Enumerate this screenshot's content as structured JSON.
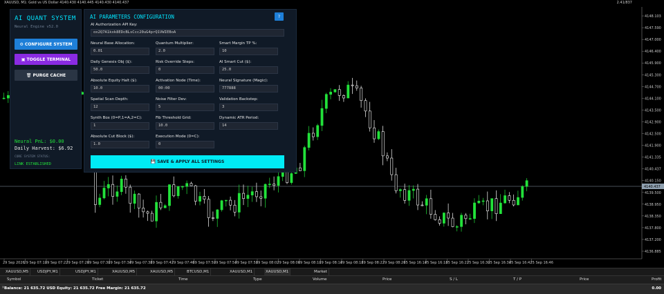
{
  "topbar": {
    "symbol_text": "XAUUSD, M1: Gold vs US Dollar  4140.430 4140.445 4140.430 4140.437",
    "right_text": "2.41/837"
  },
  "colors": {
    "accent_cyan": "#00e5ff",
    "button_blue": "#1e7fd8",
    "button_purple": "#8a2be2",
    "button_gray": "#2a3544",
    "bull_candle": "#22e23a",
    "bear_candle": "#ffffff",
    "panel_bg": "#101a27"
  },
  "left_panel": {
    "title": "AI QUANT SYSTEM",
    "subtitle": "Neural Engine v52.0",
    "buttons": [
      {
        "icon": "settings-icon",
        "label": "CONFIGURE SYSTEM"
      },
      {
        "icon": "terminal-icon",
        "label": "TOGGLE TERMINAL"
      },
      {
        "icon": "trash-icon",
        "label": "PURGE CACHE"
      }
    ],
    "pnl_text": "Neural PnL: $0.00",
    "harvest_text": "Daily Harvest: $6.92",
    "core_status_label": "CORE SYSTEM STATUS:",
    "core_status_value": "LINK ESTABLISHED"
  },
  "config": {
    "title": "AI PARAMETERS CONFIGURATION",
    "help_label": "?",
    "api_label": "AI Authorization API Key:",
    "api_value": "ox2Q7A1kxk8EDcBLsCcc20uG4prQ1VWIEBoA",
    "fields": [
      {
        "label": "Neural Base Allocation:",
        "value": "0.01"
      },
      {
        "label": "Quantum Multiplier:",
        "value": "2.0"
      },
      {
        "label": "Smart Margin TP %:",
        "value": "10"
      },
      {
        "label": "Daily Genesis Obj ($):",
        "value": "50.0"
      },
      {
        "label": "Risk Override Steps:",
        "value": "0"
      },
      {
        "label": "AI Smart Cut ($):",
        "value": "25.0"
      },
      {
        "label": "Absolute Equity Halt ($):",
        "value": "10.0"
      },
      {
        "label": "Activation Node (Time):",
        "value": "00:00"
      },
      {
        "label": "Neural Signature (Magic):",
        "value": "777888"
      },
      {
        "label": "Spatial Scan Depth:",
        "value": "12"
      },
      {
        "label": "Noise Filter Dev:",
        "value": "5"
      },
      {
        "label": "Validation Backstep:",
        "value": "3"
      },
      {
        "label": "Synth Box (0=P,1=A,2=C):",
        "value": "1"
      },
      {
        "label": "Fib Threshold Grid:",
        "value": "10.0"
      },
      {
        "label": "Dynamic ATR Period:",
        "value": "14"
      },
      {
        "label": "Absolute Cut Block ($):",
        "value": "1.0"
      },
      {
        "label": "Execution Mode (0=C):",
        "value": "0"
      }
    ],
    "save_label": "SAVE & APPLY ALL SETTINGS",
    "save_icon": "save-icon"
  },
  "chart": {
    "price_labels": [
      "4145.135",
      "4148.103",
      "4147.590",
      "4147.000",
      "4146.400",
      "4145.900",
      "4145.300",
      "4144.700",
      "4144.100",
      "4143.500",
      "4142.900",
      "4142.500",
      "4141.900",
      "4141.335",
      "4140.437",
      "4140.150",
      "4139.500",
      "4138.950",
      "4138.350",
      "4137.800",
      "4137.200",
      "4136.885"
    ],
    "current_price": "4140.437",
    "time_labels": [
      "29 Sep 2026",
      "29 Sep 07:10",
      "29 Sep 07:22",
      "29 Sep 07:26",
      "29 Sep 07:30",
      "29 Sep 07:34",
      "29 Sep 07:38",
      "29 Sep 07:42",
      "29 Sep 07:46",
      "29 Sep 07:50",
      "29 Sep 07:54",
      "29 Sep 07:58",
      "29 Sep 08:02",
      "29 Sep 08:06",
      "29 Sep 08:10",
      "29 Sep 08:14",
      "29 Sep 08:18",
      "29 Sep 08:22",
      "29 Sep 08:26",
      "25 Sep 16:14",
      "25 Sep 16:18",
      "25 Sep 16:22",
      "25 Sep 16:30",
      "25 Sep 16:34",
      "25 Sep 16:42",
      "25 Sep 16:46"
    ]
  },
  "tabs": [
    "XAUUSD,M5",
    "USDJPY,M1",
    "USDJPY,M1",
    "XAUUSD,M5",
    "XAUUSD,M5",
    "BTCUSD,M1",
    "XAUUSD,M1",
    "XAUUSD,M1",
    "Market"
  ],
  "terminal": {
    "columns": [
      "Symbol",
      "Ticket",
      "Time",
      "Type",
      "Volume",
      "Price",
      "S / L",
      "T / P",
      "Price",
      "Profit"
    ],
    "balance_text": "Balance: 21 635.72 USD  Equity: 21 635.72  Free Margin: 21 635.72",
    "profit": "0.00"
  }
}
